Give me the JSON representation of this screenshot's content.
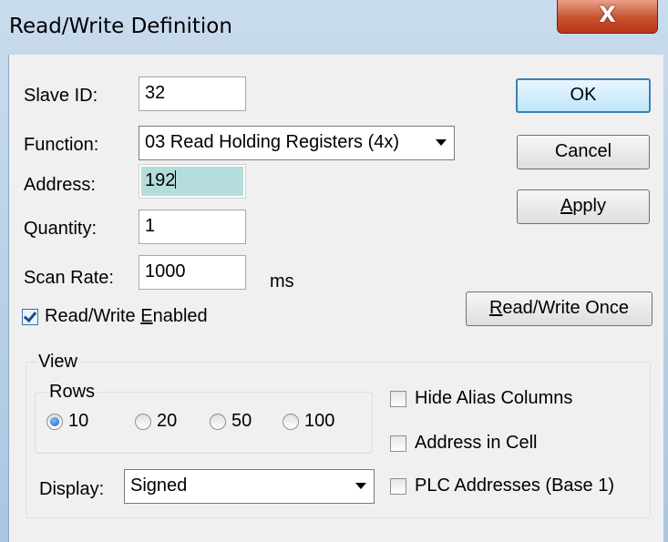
{
  "window": {
    "title": "Read/Write Definition",
    "close_glyph": "X"
  },
  "form": {
    "slave_id_label": "Slave ID:",
    "slave_id_value": "32",
    "function_label": "Function:",
    "function_value": "03 Read Holding Registers (4x)",
    "address_label": "Address:",
    "address_value": "192",
    "quantity_label": "Quantity:",
    "quantity_value": "1",
    "scan_rate_label": "Scan Rate:",
    "scan_rate_value": "1000",
    "scan_rate_unit": "ms",
    "rw_enabled_pre": "Read/Write ",
    "rw_enabled_key": "E",
    "rw_enabled_post": "nabled",
    "rw_enabled_checked": true
  },
  "buttons": {
    "ok": "OK",
    "cancel": "Cancel",
    "apply_key": "A",
    "apply_rest": "pply",
    "rw_once_key": "R",
    "rw_once_rest": "ead/Write Once"
  },
  "view": {
    "legend": "View",
    "rows_legend": "Rows",
    "rows_options": [
      "10",
      "20",
      "50",
      "100"
    ],
    "rows_selected": "10",
    "display_label": "Display:",
    "display_value": "Signed",
    "hide_alias": "Hide Alias Columns",
    "address_in_cell": "Address in Cell",
    "plc_addresses": "PLC Addresses (Base 1)"
  },
  "colors": {
    "title_gradient": [
      "#c9dced",
      "#a9c6e2"
    ],
    "close_red": "#c8502e",
    "address_highlight": "#b4dcdc",
    "default_button_border": "#3c7fb1"
  },
  "icons": [
    "close-icon",
    "dropdown-arrow-icon",
    "checkbox-checked-icon",
    "radio-selected-icon"
  ]
}
